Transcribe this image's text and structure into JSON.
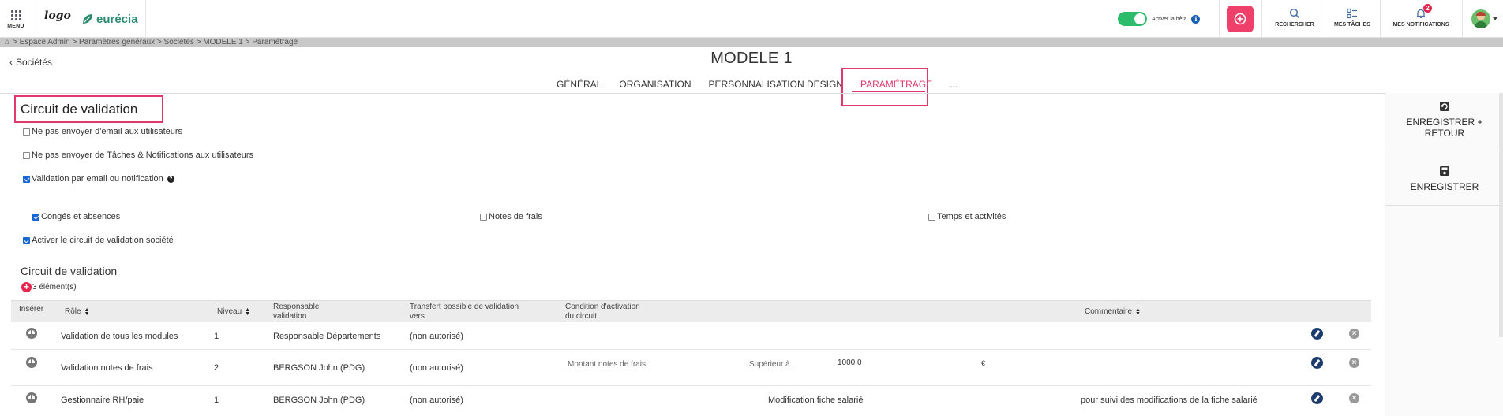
{
  "topbar": {
    "menu_label": "MENU",
    "logo_text": "logo",
    "brand_name": "eurécia",
    "beta_label": "Activer la bêta",
    "actions": [
      {
        "label": "RECHERCHER",
        "icon": "search-icon"
      },
      {
        "label": "MES TÂCHES",
        "icon": "tasks-icon"
      },
      {
        "label": "MES NOTIFICATIONS",
        "icon": "bell-icon",
        "badge": "2"
      }
    ],
    "accent_color": "#ef3f6b",
    "toggle_color": "#2dbb6c"
  },
  "breadcrumb": "> Espace Admin > Paramètres généraux > Sociétés > MODELE 1 > Paramétrage",
  "back_link": "Sociétés",
  "page_title": "MODELE 1",
  "tabs": [
    {
      "label": "GÉNÉRAL",
      "active": false
    },
    {
      "label": "ORGANISATION",
      "active": false
    },
    {
      "label": "PERSONNALISATION DESIGN",
      "active": false
    },
    {
      "label": "PARAMÉTRAGE",
      "active": true
    },
    {
      "label": "...",
      "active": false
    }
  ],
  "side_panel": {
    "save_return_line1": "ENREGISTRER +",
    "save_return_line2": "RETOUR",
    "save_label": "ENREGISTRER"
  },
  "section": {
    "title": "Circuit de validation",
    "options": [
      {
        "label": "Ne pas envoyer d'email aux utilisateurs",
        "checked": false
      },
      {
        "label": "Ne pas envoyer de Tâches & Notifications aux utilisateurs",
        "checked": false
      },
      {
        "label": "Validation par email ou notification",
        "checked": true
      }
    ],
    "modules": [
      {
        "label": "Congés et absences",
        "checked": true
      },
      {
        "label": "Notes de frais",
        "checked": false
      },
      {
        "label": "Temps et activités",
        "checked": false
      }
    ],
    "activate_label": "Activer le circuit de validation société",
    "activate_checked": true
  },
  "circuit": {
    "title": "Circuit de validation",
    "count": "3 élément(s)",
    "columns": {
      "insert": "Insérer",
      "role": "Rôle",
      "level": "Niveau",
      "responsible_1": "Responsable",
      "responsible_2": "validation",
      "transfer_1": "Transfert possible de validation",
      "transfer_2": "vers",
      "condition_1": "Condition d'activation",
      "condition_2": "du circuit",
      "comment": "Commentaire"
    },
    "rows": [
      {
        "role": "Validation de tous les modules",
        "level": "1",
        "responsible": "Responsable Départements",
        "transfer": "(non autorisé)",
        "condition": "",
        "operator": "",
        "value": "",
        "unit": "",
        "comment": ""
      },
      {
        "role": "Validation notes de frais",
        "level": "2",
        "responsible": "BERGSON John (PDG)",
        "transfer": "(non autorisé)",
        "condition": "Montant notes de frais",
        "operator": "Supérieur à",
        "value": "1000.0",
        "unit": "€",
        "comment": ""
      },
      {
        "role": "Gestionnaire RH/paie",
        "level": "1",
        "responsible": "BERGSON John (PDG)",
        "transfer": "(non autorisé)",
        "condition": "Modification fiche salarié",
        "operator": "",
        "value": "",
        "unit": "",
        "comment": "pour suivi des modifications de la fiche salarié"
      }
    ]
  }
}
